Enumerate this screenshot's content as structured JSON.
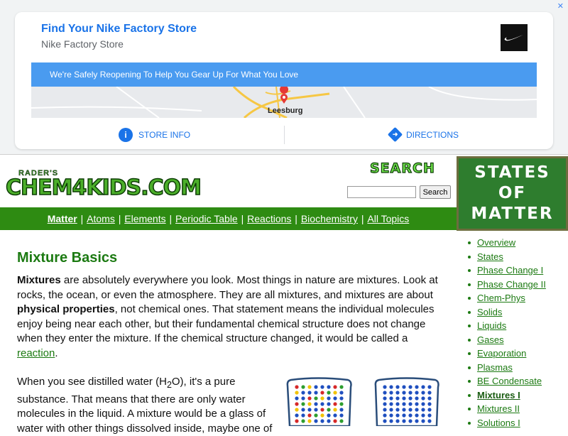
{
  "ad": {
    "close": "✕",
    "title": "Find Your Nike Factory Store",
    "subtitle": "Nike Factory Store",
    "banner": "We're Safely Reopening To Help You Gear Up For What You Love",
    "map_label": "Leesburg",
    "store_info": "STORE INFO",
    "directions": "DIRECTIONS"
  },
  "header": {
    "logo_top": "RADER'S",
    "logo_main": "CHEM4KIDS.COM",
    "search_title": "SEARCH",
    "search_button": "Search",
    "search_value": ""
  },
  "states_box": {
    "line1": "STATES",
    "line2": "OF",
    "line3": "MATTER"
  },
  "nav": {
    "items": [
      "Matter",
      "Atoms",
      "Elements",
      "Periodic Table",
      "Reactions",
      "Biochemistry",
      "All Topics"
    ]
  },
  "content": {
    "title": "Mixture Basics",
    "p1_bold1": "Mixtures",
    "p1_text1": " are absolutely everywhere you look. Most things in nature are mixtures. Look at rocks, the ocean, or even the atmosphere. They are all mixtures, and mixtures are about ",
    "p1_bold2": "physical properties",
    "p1_text2": ", not chemical ones. That statement means the individual molecules enjoy being near each other, but their fundamental chemical structure does not change when they enter the mixture. If the chemical structure changed, it would be called a ",
    "p1_link": "reaction",
    "p1_end": ".",
    "p2_a": "When you see distilled water (H",
    "p2_sub": "2",
    "p2_b": "O), it's a pure substance. That means that there are only water molecules in the liquid. A mixture would be a glass of water with other things dissolved inside, maybe one of"
  },
  "sidebar": {
    "items": [
      "Overview",
      "States",
      "Phase Change I",
      "Phase Change II",
      "Chem-Phys",
      "Solids",
      "Liquids",
      "Gases",
      "Evaporation",
      "Plasmas",
      "BE Condensate",
      "Mixtures I",
      "Mixtures II",
      "Solutions I"
    ]
  }
}
